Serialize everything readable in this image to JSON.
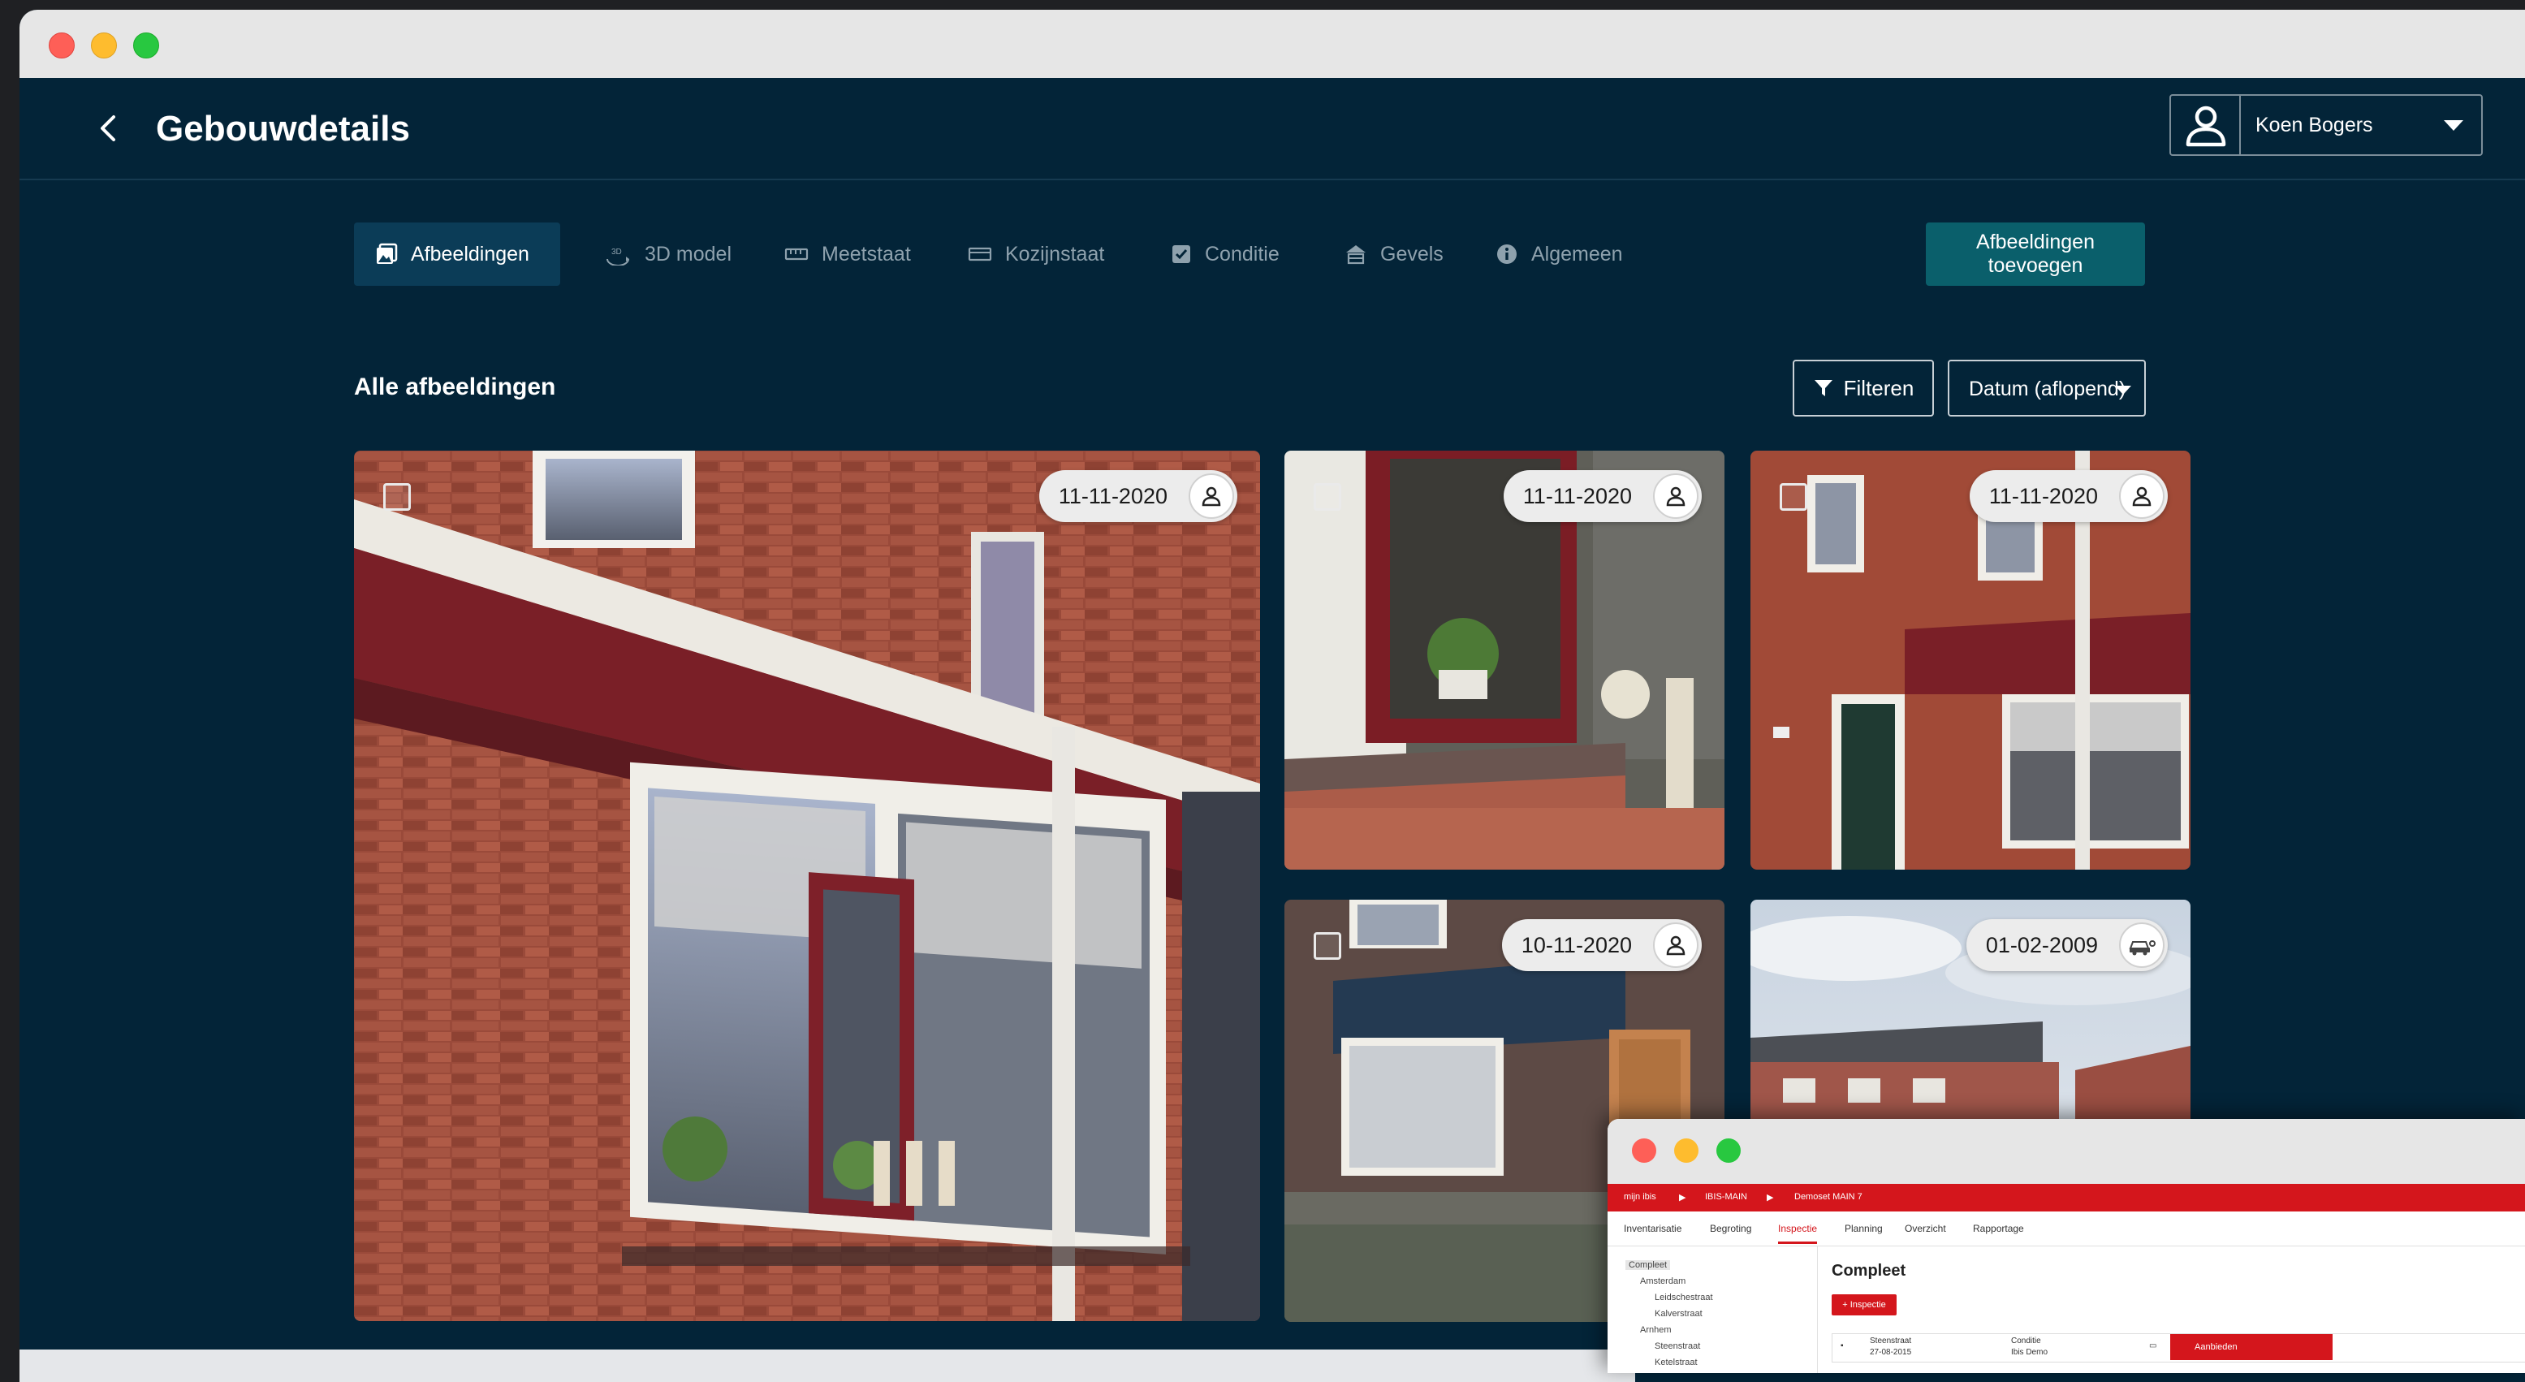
{
  "header": {
    "title": "Gebouwdetails",
    "user_name": "Koen Bogers"
  },
  "tabs": [
    {
      "label": "Afbeeldingen",
      "icon": "image-icon",
      "active": true
    },
    {
      "label": "3D model",
      "icon": "cube-3d-icon",
      "active": false
    },
    {
      "label": "Meetstaat",
      "icon": "ruler-icon",
      "active": false
    },
    {
      "label": "Kozijnstaat",
      "icon": "window-frame-icon",
      "active": false
    },
    {
      "label": "Conditie",
      "icon": "checkbox-icon",
      "active": false
    },
    {
      "label": "Gevels",
      "icon": "house-facade-icon",
      "active": false
    },
    {
      "label": "Algemeen",
      "icon": "info-icon",
      "active": false
    }
  ],
  "actions": {
    "add_images": "Afbeeldingen toevoegen",
    "filter": "Filteren",
    "sort_selected": "Datum (aflopend)"
  },
  "section": {
    "title": "Alle afbeeldingen"
  },
  "photos": [
    {
      "date": "11-11-2020",
      "source_icon": "user-icon",
      "selected": false
    },
    {
      "date": "11-11-2020",
      "source_icon": "user-icon",
      "selected": false
    },
    {
      "date": "11-11-2020",
      "source_icon": "user-icon",
      "selected": false
    },
    {
      "date": "10-11-2020",
      "source_icon": "user-icon",
      "selected": false
    },
    {
      "date": "01-02-2009",
      "source_icon": "street-view-car-icon",
      "selected": false
    }
  ],
  "overlay_window": {
    "breadcrumbs": [
      "mijn ibis",
      "IBIS-MAIN",
      "Demoset MAIN 7"
    ],
    "nav": [
      "Inventarisatie",
      "Begroting",
      "Inspectie",
      "Planning",
      "Overzicht",
      "Rapportage"
    ],
    "nav_active": "Inspectie",
    "tree": [
      "Compleet",
      "Amsterdam",
      "Leidschestraat",
      "Kalverstraat",
      "Arnhem",
      "Steenstraat",
      "Ketelstraat"
    ],
    "title": "Compleet",
    "new_button": "+ Inspectie",
    "row": {
      "street": "Steenstraat",
      "date": "27-08-2015",
      "type": "Conditie",
      "owner": "Ibis Demo",
      "action": "Aanbieden"
    }
  },
  "colors": {
    "app_background": "#032438",
    "active_tab": "#0b3c57",
    "primary_button": "#0a5f6b",
    "overlay_accent": "#d4161c"
  }
}
